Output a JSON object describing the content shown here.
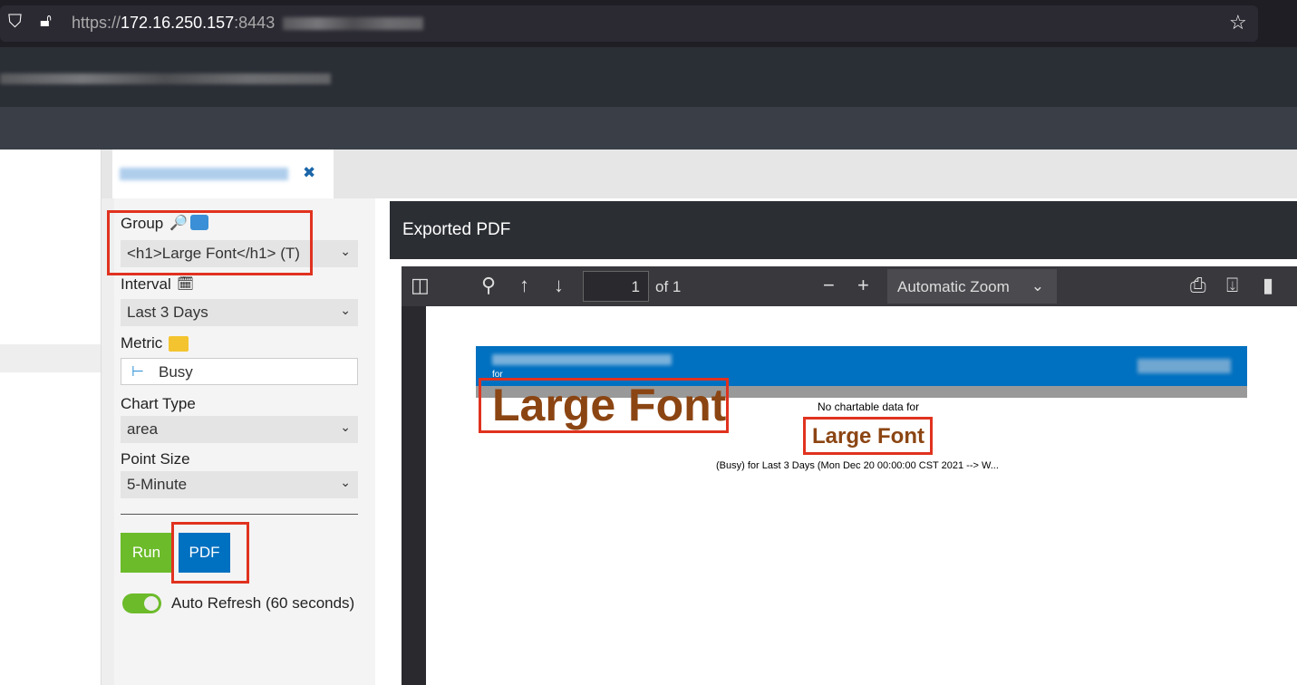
{
  "browser": {
    "url_prefix": "https://",
    "url_host": "172.16.250.157",
    "url_port": ":8443"
  },
  "tab": {
    "close": "✖"
  },
  "form": {
    "group_label": "Group",
    "group_value": "<h1>Large Font</h1> (T)",
    "interval_label": "Interval",
    "interval_value": "Last 3 Days",
    "metric_label": "Metric",
    "metric_value": "Busy",
    "chart_type_label": "Chart Type",
    "chart_type_value": "area",
    "point_size_label": "Point Size",
    "point_size_value": "5-Minute",
    "run": "Run",
    "pdf": "PDF",
    "auto_refresh": "Auto Refresh (60 seconds)"
  },
  "viewer": {
    "title": "Exported PDF",
    "page": "1",
    "of": "of 1",
    "zoom": "Automatic Zoom"
  },
  "pdf": {
    "for": "for",
    "group": "Large Font",
    "no_data": "No chartable data for",
    "group2": "Large Font",
    "subtitle": "(Busy) for Last 3 Days (Mon Dec 20 00:00:00 CST 2021 --> W..."
  },
  "colors": {
    "accent": "#0070c0",
    "run": "#6cbb2a",
    "heading": "#8b4513",
    "highlight": "#e0321f"
  }
}
